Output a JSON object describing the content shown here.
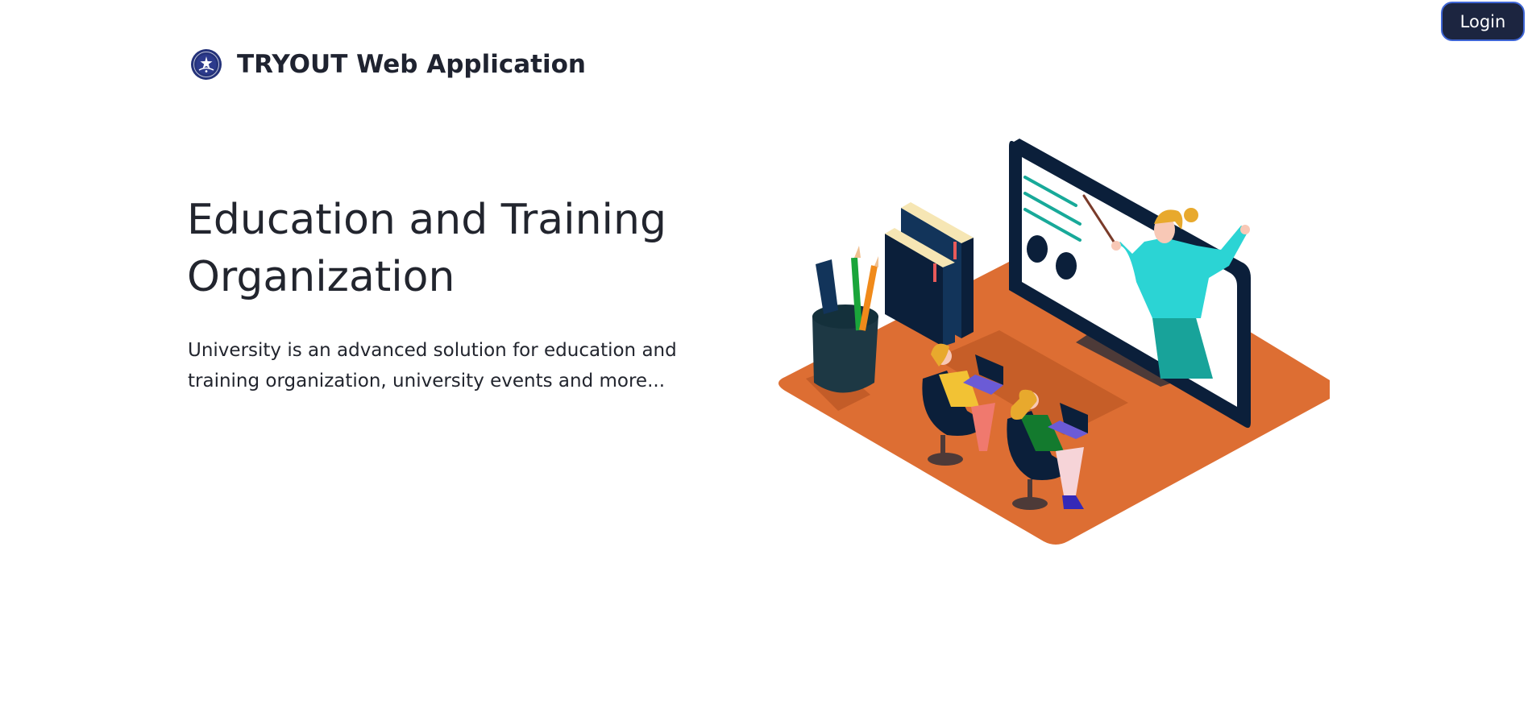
{
  "header": {
    "brand_name": "TRYOUT Web Application",
    "login_label": "Login"
  },
  "hero": {
    "title": "Education and Training Organization",
    "description": "University is an advanced solution for education and training organization, university events and more..."
  },
  "icons": {
    "logo": "university-logo-icon",
    "illustration": "online-classroom-illustration"
  },
  "colors": {
    "login_background": "#1c2540",
    "login_border": "#3f66d6",
    "platform_orange": "#dd6e33",
    "navy": "#0b1f3a",
    "teal": "#2bd4d4"
  }
}
